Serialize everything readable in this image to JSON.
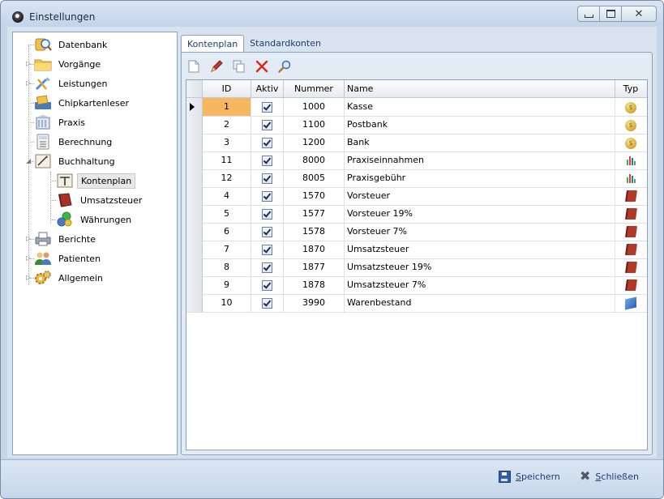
{
  "window": {
    "title": "Einstellungen",
    "close_glyph": "✕"
  },
  "tree": {
    "items": [
      {
        "label": "Datenbank",
        "icon": "database-search-icon"
      },
      {
        "label": "Vorgänge",
        "icon": "folder-icon"
      },
      {
        "label": "Leistungen",
        "icon": "tools-icon"
      },
      {
        "label": "Chipkartenleser",
        "icon": "card-reader-icon"
      },
      {
        "label": "Praxis",
        "icon": "building-icon"
      },
      {
        "label": "Berechnung",
        "icon": "calculator-icon"
      },
      {
        "label": "Buchhaltung",
        "icon": "accounting-icon"
      },
      {
        "label": "Kontenplan",
        "icon": "account-chart-icon"
      },
      {
        "label": "Umsatzsteuer",
        "icon": "book-icon"
      },
      {
        "label": "Währungen",
        "icon": "currency-icon"
      },
      {
        "label": "Berichte",
        "icon": "printer-icon"
      },
      {
        "label": "Patienten",
        "icon": "patients-icon"
      },
      {
        "label": "Allgemein",
        "icon": "gears-icon"
      }
    ]
  },
  "tabs": [
    {
      "label": "Kontenplan"
    },
    {
      "label": "Standardkonten"
    }
  ],
  "toolbar": {
    "icons": [
      "new-icon",
      "edit-icon",
      "copy-icon",
      "delete-icon",
      "search-icon"
    ]
  },
  "grid": {
    "headers": {
      "id": "ID",
      "aktiv": "Aktiv",
      "nummer": "Nummer",
      "name": "Name",
      "typ": "Typ"
    },
    "rows": [
      {
        "id": "1",
        "aktiv": true,
        "nummer": "1000",
        "name": "Kasse",
        "typ": "coin"
      },
      {
        "id": "2",
        "aktiv": true,
        "nummer": "1100",
        "name": "Postbank",
        "typ": "coin"
      },
      {
        "id": "3",
        "aktiv": true,
        "nummer": "1200",
        "name": "Bank",
        "typ": "coin"
      },
      {
        "id": "11",
        "aktiv": true,
        "nummer": "8000",
        "name": "Praxiseinnahmen",
        "typ": "chart"
      },
      {
        "id": "12",
        "aktiv": true,
        "nummer": "8005",
        "name": "Praxisgebühr",
        "typ": "chart"
      },
      {
        "id": "4",
        "aktiv": true,
        "nummer": "1570",
        "name": "Vorsteuer",
        "typ": "book"
      },
      {
        "id": "5",
        "aktiv": true,
        "nummer": "1577",
        "name": "Vorsteuer 19%",
        "typ": "book"
      },
      {
        "id": "6",
        "aktiv": true,
        "nummer": "1578",
        "name": "Vorsteuer 7%",
        "typ": "book"
      },
      {
        "id": "7",
        "aktiv": true,
        "nummer": "1870",
        "name": "Umsatzsteuer",
        "typ": "book"
      },
      {
        "id": "8",
        "aktiv": true,
        "nummer": "1877",
        "name": "Umsatzsteuer 19%",
        "typ": "book"
      },
      {
        "id": "9",
        "aktiv": true,
        "nummer": "1878",
        "name": "Umsatzsteuer 7%",
        "typ": "book"
      },
      {
        "id": "10",
        "aktiv": true,
        "nummer": "3990",
        "name": "Warenbestand",
        "typ": "box"
      }
    ]
  },
  "footer": {
    "save": {
      "label_first": "S",
      "label_rest": "peichern"
    },
    "close": {
      "label_first": "S",
      "label_rest": "chließen"
    }
  },
  "colors": {
    "selected_cell": "#f7b760",
    "accent": "#1d3c73"
  }
}
